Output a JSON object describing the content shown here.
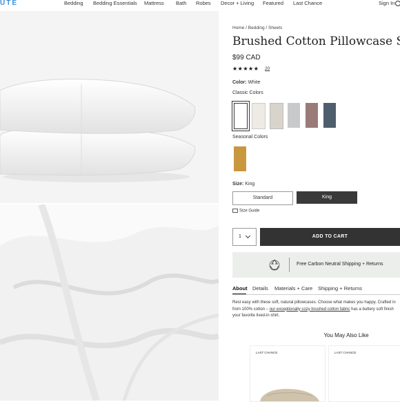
{
  "nav": {
    "logo": "UTE",
    "items": [
      "Bedding",
      "Bedding Essentials",
      "Mattress",
      "Bath",
      "Robes",
      "Decor + Living",
      "Featured",
      "Last Chance"
    ],
    "sign_in": "Sign In"
  },
  "product": {
    "breadcrumb": "Home / Bedding / Sheets",
    "title": "Brushed Cotton Pillowcase S",
    "price": "$99 CAD",
    "rating_stars": "★★★★★",
    "rating": 4.5,
    "review_count": "20",
    "color_label": "Color:",
    "color_value": "White",
    "classic_colors_label": "Classic Colors",
    "classic_colors": [
      "#ffffff",
      "#eeebe4",
      "#d9d4cb",
      "#c8c9cb",
      "#9a7b78",
      "#4f5e6c"
    ],
    "seasonal_colors_label": "Seasonal Colors",
    "seasonal_colors": [
      "#c9973d"
    ],
    "size_label": "Size:",
    "size_value": "King",
    "sizes": [
      "Standard",
      "King"
    ],
    "size_guide": "Size Guide",
    "quantity": "1",
    "add_to_cart": "ADD TO CART"
  },
  "shipping": {
    "text": "Free Carbon Neutral Shipping + Returns"
  },
  "tabs": [
    "About",
    "Details",
    "Materials + Care",
    "Shipping + Returns"
  ],
  "description": {
    "line1": "Rest easy with these soft, natural pillowcases. Choose what makes you happy. Crafted in",
    "line2_pre": "from 100% cotton – ",
    "line2_link": "our exceptionally cozy brushed cotton fabric",
    "line2_post": " has a buttery soft finish",
    "line3": "your favorite lived-in shirt."
  },
  "recommendations": {
    "heading": "You May Also Like",
    "badges": [
      "LAST CHANCE",
      "LAST CHANCE"
    ]
  }
}
